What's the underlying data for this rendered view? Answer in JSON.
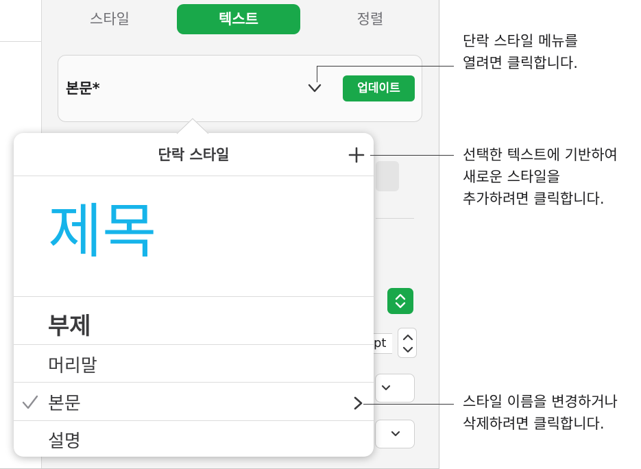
{
  "inspector": {
    "tabs": {
      "style": "스타일",
      "text": "텍스트",
      "align": "정렬"
    },
    "current_style": "본문*",
    "update_button": "업데이트",
    "point_label": "pt"
  },
  "popover": {
    "title": "단락 스타일",
    "items": [
      {
        "label": "제목"
      },
      {
        "label": "부제"
      },
      {
        "label": "머리말"
      },
      {
        "label": "본문",
        "selected": true
      },
      {
        "label": "설명"
      }
    ]
  },
  "callouts": {
    "menu": [
      "단락 스타일 메뉴를",
      "열려면 클릭합니다."
    ],
    "add": [
      "선택한 텍스트에 기반하여",
      "새로운 스타일을",
      "추가하려면 클릭합니다."
    ],
    "rename": [
      "스타일 이름을 변경하거나",
      "삭제하려면 클릭합니다."
    ]
  },
  "colors": {
    "accent_green": "#19a84a",
    "title_blue": "#16b4ea"
  },
  "icons": [
    "chevron-down-icon",
    "plus-icon",
    "checkmark-icon",
    "chevron-right-icon",
    "up-down-arrows-icon"
  ]
}
